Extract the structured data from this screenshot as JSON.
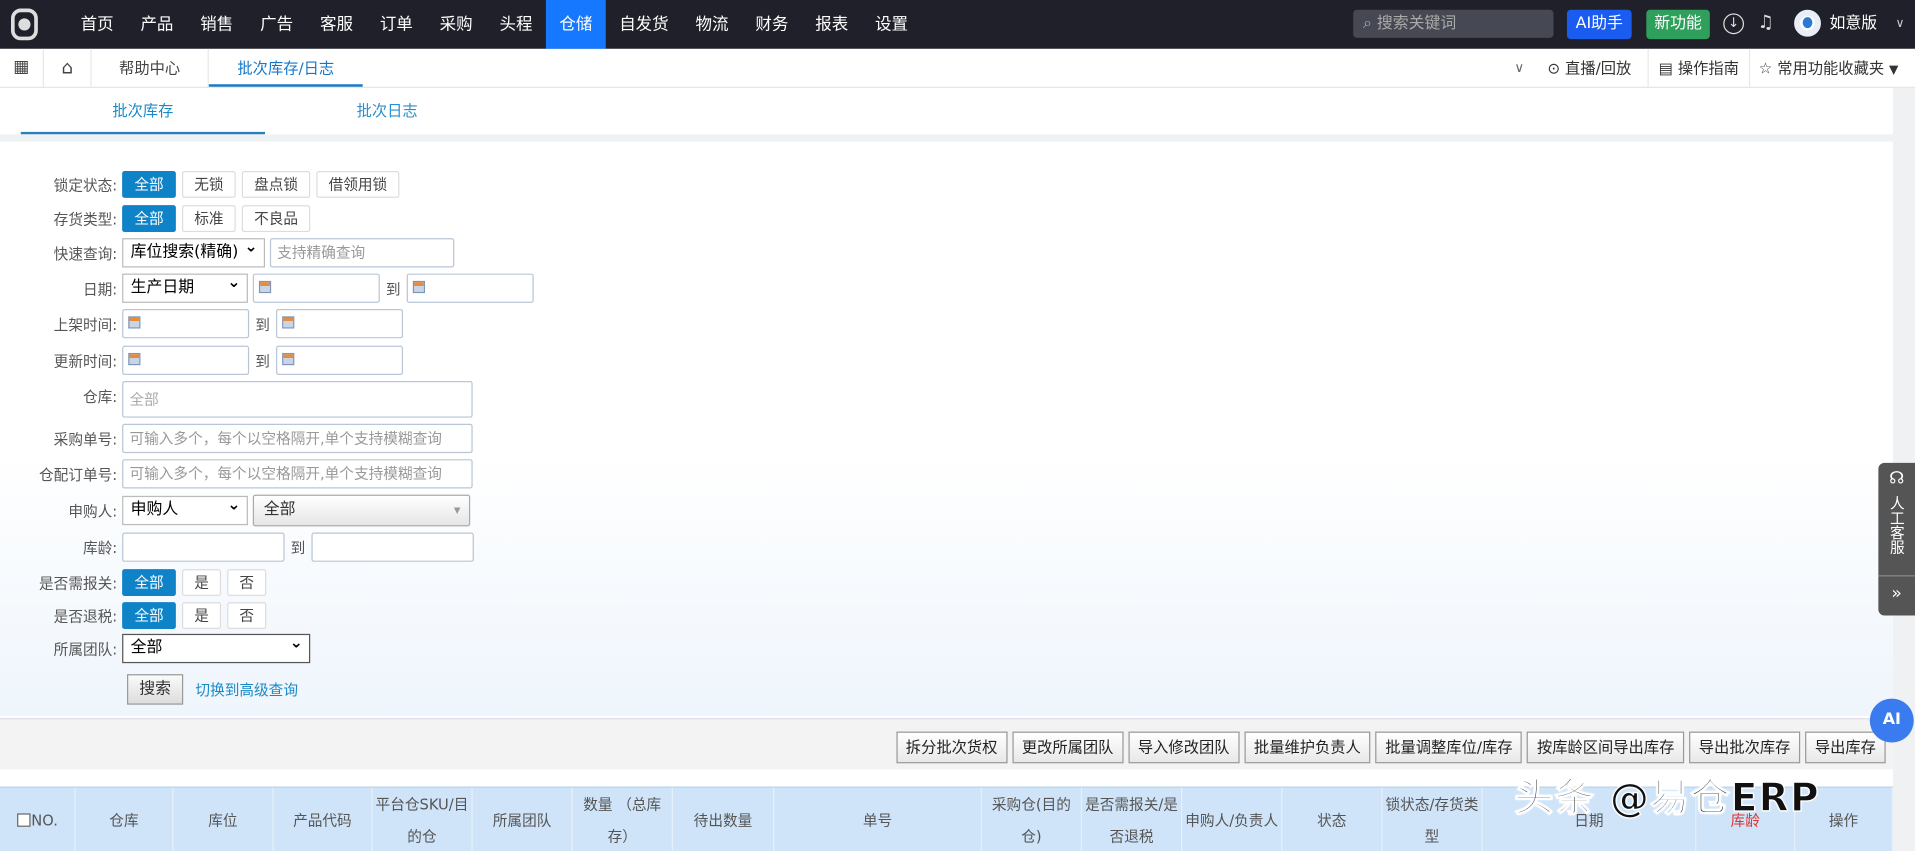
{
  "topnav": {
    "items": [
      "首页",
      "产品",
      "销售",
      "广告",
      "客服",
      "订单",
      "采购",
      "头程",
      "仓储",
      "自发货",
      "物流",
      "财务",
      "报表",
      "设置"
    ],
    "active_index": 8,
    "search_placeholder": "搜索关键词",
    "ai_label": "AI助手",
    "new_label": "新功能",
    "user": "如意版"
  },
  "tabbar": {
    "help": "帮助中心",
    "active": "批次库存/日志",
    "live": "直播/回放",
    "guide": "操作指南",
    "favorites": "常用功能收藏夹"
  },
  "subtabs": [
    "批次库存",
    "批次日志"
  ],
  "form": {
    "lock_label": "锁定状态:",
    "lock_options": [
      "全部",
      "无锁",
      "盘点锁",
      "借领用锁"
    ],
    "type_label": "存货类型:",
    "type_options": [
      "全部",
      "标准",
      "不良品"
    ],
    "quick_label": "快速查询:",
    "quick_select": "库位搜索(精确)",
    "quick_placeholder": "支持精确查询",
    "date_label": "日期:",
    "date_select": "生产日期",
    "to": "到",
    "shelf_label": "上架时间:",
    "update_label": "更新时间:",
    "wh_label": "仓库:",
    "wh_placeholder": "全部",
    "po_label": "采购单号:",
    "po_placeholder": "可输入多个，每个以空格隔开,单个支持模糊查询",
    "wo_label": "仓配订单号:",
    "wo_placeholder": "可输入多个，每个以空格隔开,单个支持模糊查询",
    "buyer_label": "申购人:",
    "buyer_select": "申购人",
    "buyer_value": "全部",
    "age_label": "库龄:",
    "customs_label": "是否需报关:",
    "yn_options": [
      "全部",
      "是",
      "否"
    ],
    "tax_label": "是否退税:",
    "team_label": "所属团队:",
    "team_value": "全部",
    "search_btn": "搜索",
    "advanced_link": "切换到高级查询"
  },
  "actions": [
    "拆分批次货权",
    "更改所属团队",
    "导入修改团队",
    "批量维护负责人",
    "批量调整库位/库存",
    "按库龄区间导出库存",
    "导出批次库存",
    "导出库存"
  ],
  "table": {
    "headers": [
      "NO.",
      "仓库",
      "库位",
      "产品代码",
      "平台仓SKU/目的仓",
      "所属团队",
      "数量 （总库存）",
      "待出数量",
      "单号",
      "采购仓(目的仓)",
      "是否需报关/是否退税",
      "申购人/负责人",
      "状态",
      "锁状态/存货类型",
      "日期",
      "库龄",
      "操作"
    ]
  },
  "side": {
    "kefu": "人工客服",
    "more": "»",
    "ai": "AI"
  },
  "watermark": "头条 @易仓ERP"
}
